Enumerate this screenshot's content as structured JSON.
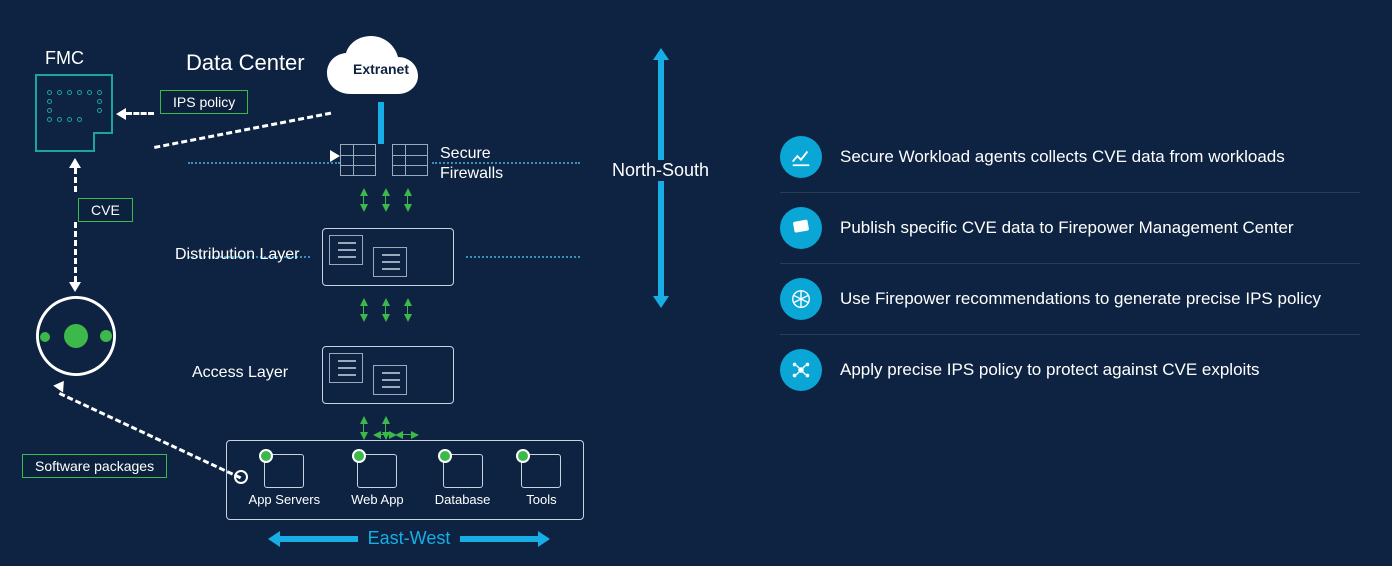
{
  "left": {
    "fmc_label": "FMC",
    "data_center": "Data Center",
    "cloud": "Extranet",
    "badge_ips": "IPS policy",
    "badge_cve": "CVE",
    "badge_sw": "Software packages",
    "firewall_label": "Secure\nFirewalls",
    "dist_label": "Distribution Layer",
    "acc_label": "Access Layer",
    "workloads": {
      "a": "App Servers",
      "b": "Web App",
      "c": "Database",
      "d": "Tools"
    },
    "east_west": "East-West",
    "north_south": "North-South"
  },
  "bullets": {
    "b1": "Secure Workload agents collects CVE data from workloads",
    "b2": "Publish specific CVE data to Firepower Management Center",
    "b3": "Use Firepower recommendations to generate precise IPS policy",
    "b4": "Apply precise IPS policy to protect against CVE exploits"
  }
}
